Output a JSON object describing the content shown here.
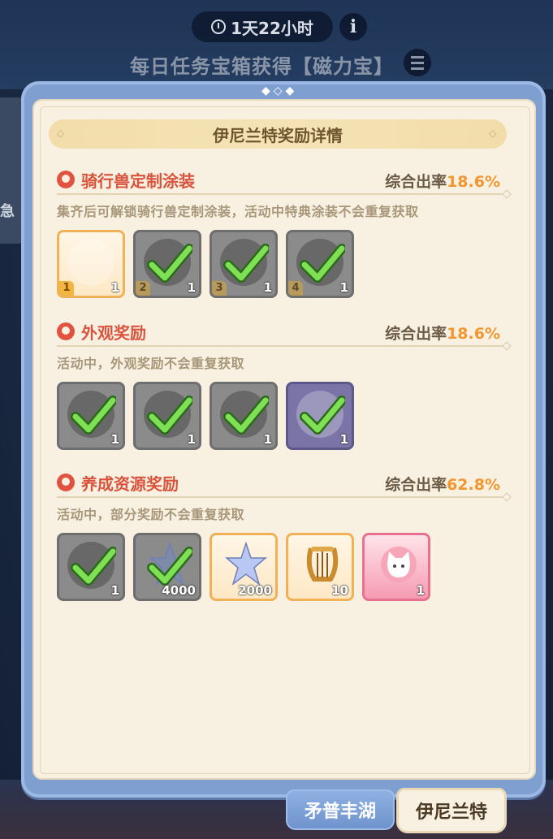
{
  "top": {
    "timer": "1天22小时",
    "info_glyph": "i",
    "daily_title": "每日任务宝箱获得【磁力宝】",
    "side_text": "急"
  },
  "panel": {
    "title": "伊尼兰特奖励详情",
    "sections": [
      {
        "title": "骑行兽定制涂装",
        "rate_label": "综合出率",
        "rate_value": "18.6%",
        "desc": "集齐后可解锁骑行兽定制涂装，活动中特典涂装不会重复获取",
        "items": [
          {
            "icon": "mount-skin-icon",
            "qty": "1",
            "level": "1",
            "style": "orange",
            "claimed": false
          },
          {
            "icon": "mount-skin-icon",
            "qty": "1",
            "level": "2",
            "style": "done",
            "claimed": true
          },
          {
            "icon": "mount-skin-icon",
            "qty": "1",
            "level": "3",
            "style": "done",
            "claimed": true
          },
          {
            "icon": "mount-skin-icon",
            "qty": "1",
            "level": "4",
            "style": "done",
            "claimed": true
          }
        ]
      },
      {
        "title": "外观奖励",
        "rate_label": "综合出率",
        "rate_value": "18.6%",
        "desc": "活动中，外观奖励不会重复获取",
        "items": [
          {
            "icon": "cape-icon",
            "qty": "1",
            "style": "done",
            "claimed": true
          },
          {
            "icon": "outfit-icon",
            "qty": "1",
            "style": "done",
            "claimed": true
          },
          {
            "icon": "headgear-icon",
            "qty": "1",
            "style": "done",
            "claimed": true
          },
          {
            "icon": "frame-icon",
            "qty": "1",
            "style": "purple",
            "claimed": true
          }
        ]
      },
      {
        "title": "养成资源奖励",
        "rate_label": "综合出率",
        "rate_value": "62.8%",
        "desc": "活动中，部分奖励不会重复获取",
        "items": [
          {
            "icon": "scroll-icon",
            "qty": "1",
            "style": "done",
            "claimed": true
          },
          {
            "icon": "crystal-star-icon",
            "qty": "4000",
            "style": "done",
            "claimed": true
          },
          {
            "icon": "crystal-star-icon",
            "qty": "2000",
            "style": "orange",
            "claimed": false
          },
          {
            "icon": "lyre-icon",
            "qty": "10",
            "style": "orange",
            "claimed": false
          },
          {
            "icon": "cat-avatar-icon",
            "qty": "1",
            "style": "pink",
            "claimed": false
          }
        ]
      }
    ]
  },
  "tabs": {
    "tab1": "矛普丰湖",
    "tab2": "伊尼兰特"
  }
}
